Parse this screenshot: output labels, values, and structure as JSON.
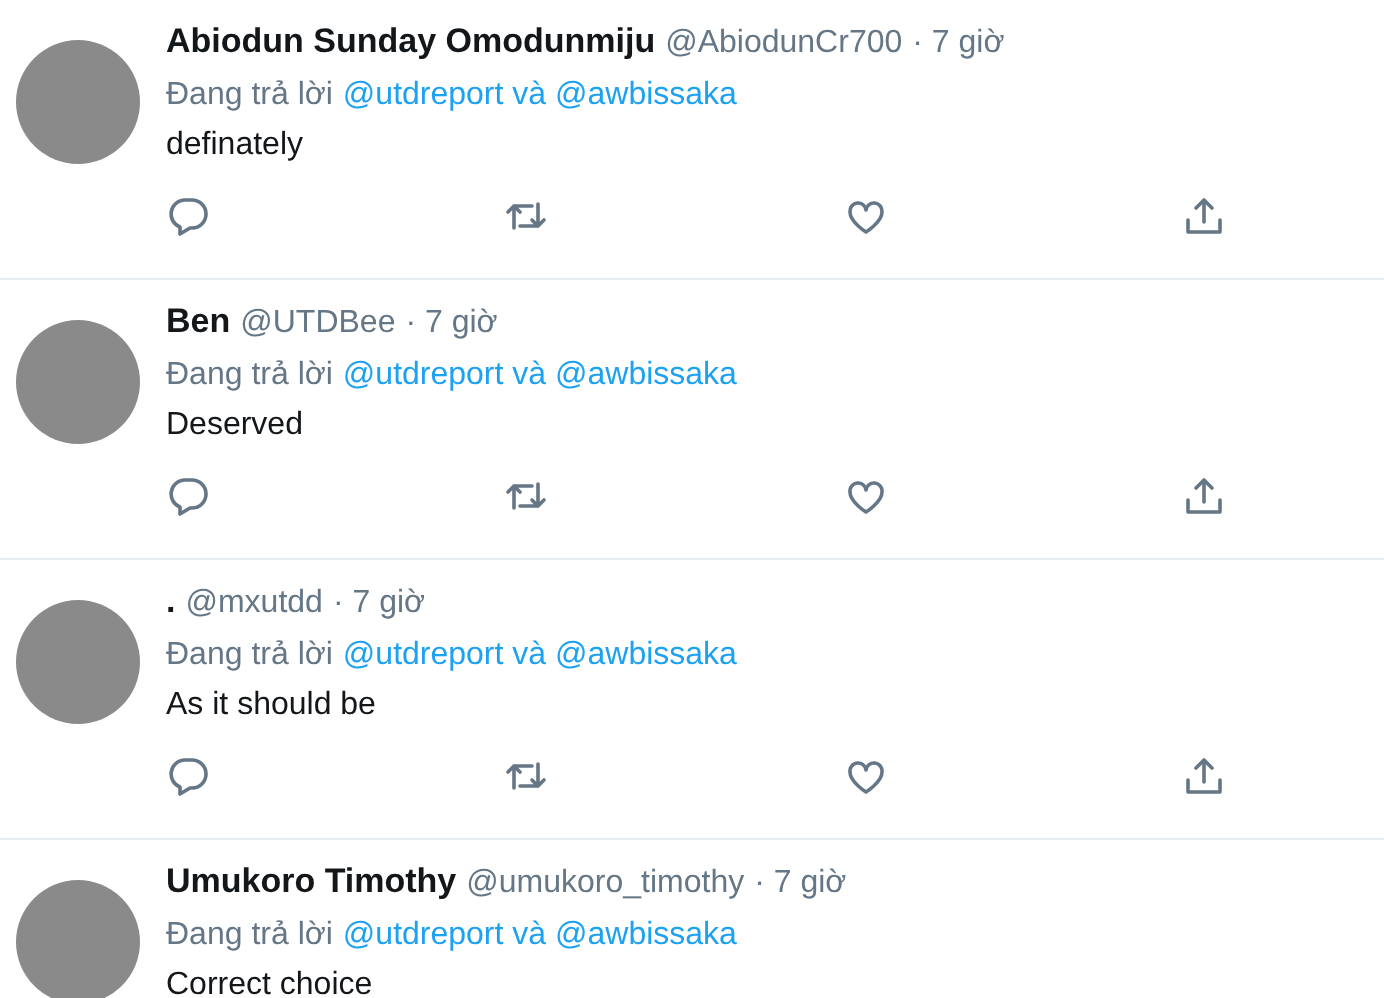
{
  "tweets": [
    {
      "name": "Abiodun Sunday Omodunmiju",
      "handle": "@AbiodunCr700",
      "time": "· 7 giờ",
      "reply_prefix": "Đang trả lời",
      "reply_to": "@utdreport và @awbissaka",
      "text": "definately"
    },
    {
      "name": "Ben",
      "handle": "@UTDBee",
      "time": "· 7 giờ",
      "reply_prefix": "Đang trả lời",
      "reply_to": "@utdreport và @awbissaka",
      "text": "Deserved"
    },
    {
      "name": ".",
      "handle": "@mxutdd",
      "time": "· 7 giờ",
      "reply_prefix": "Đang trả lời",
      "reply_to": "@utdreport và @awbissaka",
      "text": "As it should be"
    },
    {
      "name": "Umukoro Timothy",
      "handle": "@umukoro_timothy",
      "time": "· 7 giờ",
      "reply_prefix": "Đang trả lời",
      "reply_to": "@utdreport và @awbissaka",
      "text": "Correct choice"
    }
  ]
}
